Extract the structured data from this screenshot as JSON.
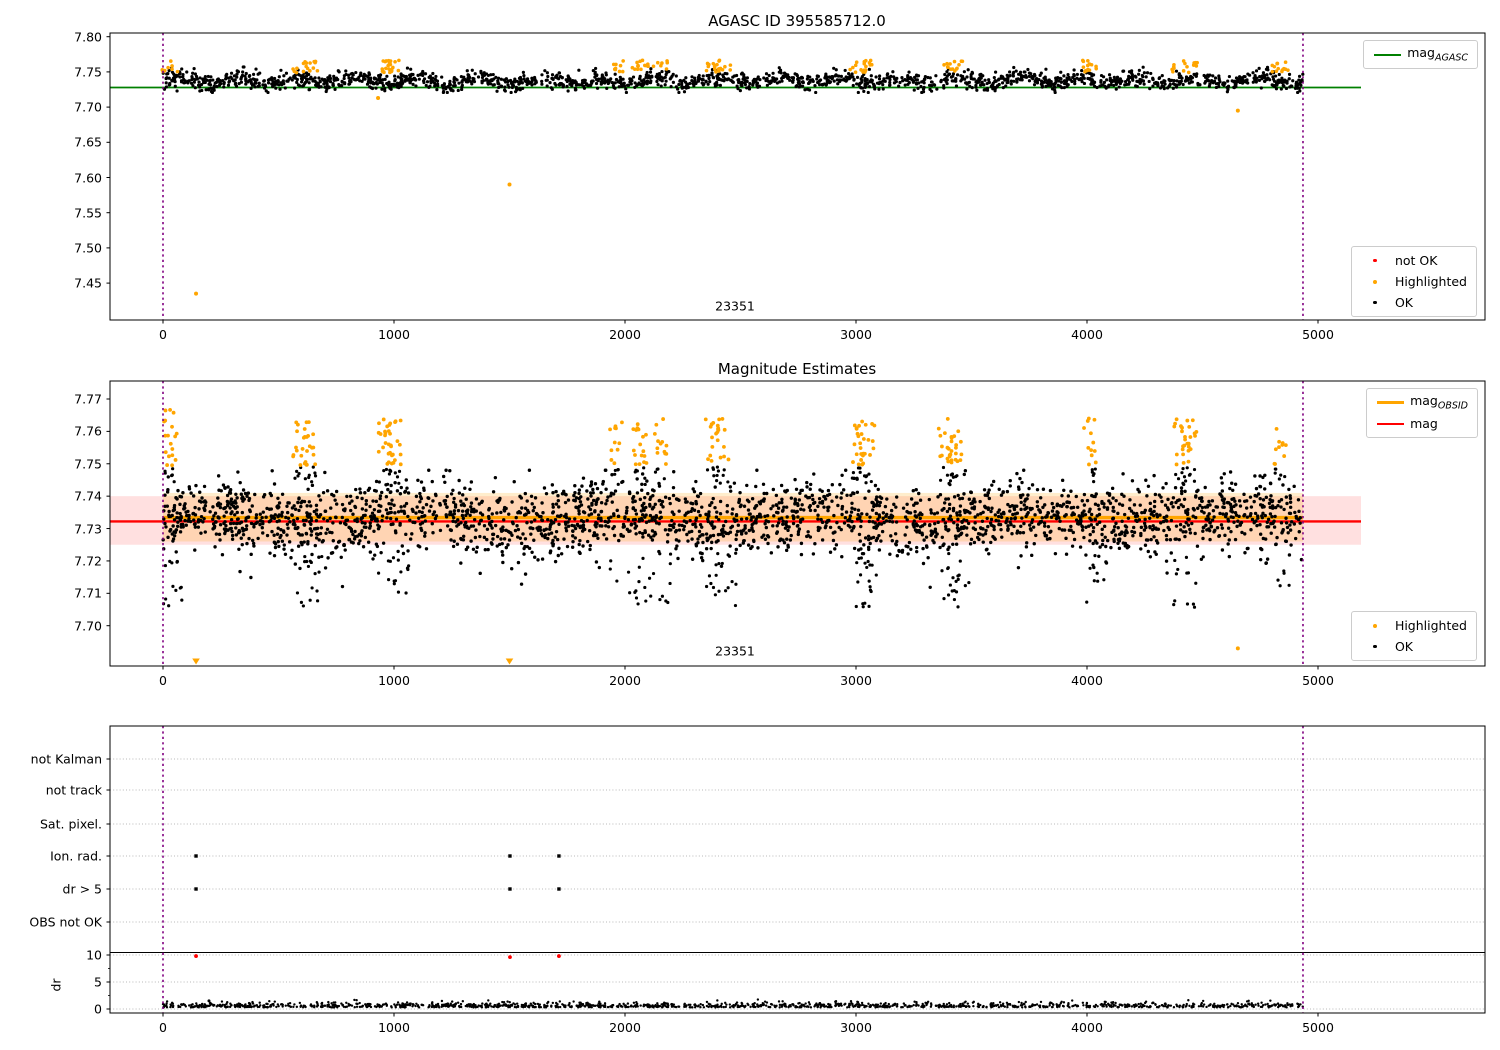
{
  "colors": {
    "ok": "#000000",
    "highlighted": "#ffa500",
    "not_ok": "#ff0000",
    "mag_agasc": "#008000",
    "mag": "#ff0000",
    "mag_obsid": "#ffa500",
    "obs_marker": "#800080",
    "grid": "#b8b8b8",
    "band_mag": "rgba(255,0,0,0.12)",
    "band_obsid": "rgba(255,165,0,0.20)"
  },
  "chart_data": [
    {
      "name": "agasc-mag-panel",
      "type": "scatter",
      "title": "AGASC ID 395585712.0",
      "y_ticks": [
        7.8,
        7.75,
        7.7,
        7.65,
        7.6,
        7.55,
        7.5,
        7.45
      ],
      "x_ticks": [
        0,
        1000,
        2000,
        3000,
        4000,
        5000
      ],
      "ylim": [
        7.3975,
        7.8053
      ],
      "obsid_label": "23351",
      "obs_interval": [
        0,
        4935
      ],
      "mag_agasc_line": 7.7278,
      "legend_line": {
        "main": "mag",
        "sub": "AGASC"
      },
      "legend_points": [
        {
          "label": "not OK",
          "color": "#ff0000"
        },
        {
          "label": "Highlighted",
          "color": "#ffa500"
        },
        {
          "label": "OK",
          "color": "#000000"
        }
      ],
      "black_band": {
        "n": 1900,
        "mean": 7.7375,
        "sd": 0.0058,
        "min": 7.7208,
        "max": 7.757,
        "wave_amp": 0.004,
        "wave_period": 260
      },
      "orange_cluster_x": [
        30,
        593,
        636,
        961,
        1004,
        1965,
        2065,
        2151,
        2376,
        2424,
        3009,
        3052,
        3385,
        3429,
        4013,
        4403,
        4446,
        4835
      ],
      "orange_cluster_y": [
        7.749,
        7.7665
      ],
      "orange_outliers": [
        [
          143,
          7.435
        ],
        [
          1500,
          7.59
        ],
        [
          931,
          7.713
        ],
        [
          4653,
          7.695
        ]
      ]
    },
    {
      "name": "magnitude-estimates-panel",
      "type": "scatter",
      "title": "Magnitude Estimates",
      "y_ticks": [
        7.77,
        7.76,
        7.75,
        7.74,
        7.73,
        7.72,
        7.71,
        7.7
      ],
      "x_ticks": [
        0,
        1000,
        2000,
        3000,
        4000,
        5000
      ],
      "obsid_label": "23351",
      "obs_interval": [
        0,
        4935
      ],
      "mag": 7.7325,
      "mag_obsid": 7.733,
      "mag_band": [
        7.725,
        7.74
      ],
      "mag_obsid_band": [
        7.726,
        7.741
      ],
      "legend_lines": [
        {
          "main": "mag",
          "sub": "OBSID",
          "color": "#ffa500"
        },
        {
          "main": "mag",
          "sub": "",
          "color": "#ff0000"
        }
      ],
      "legend_points": [
        {
          "label": "Highlighted",
          "color": "#ffa500"
        },
        {
          "label": "OK",
          "color": "#000000"
        }
      ],
      "black_band": {
        "n": 2600,
        "mean": 7.7332,
        "sd": 0.0056,
        "min": 7.7045,
        "max": 7.748
      },
      "black_dip_cluster_x": [
        30,
        593,
        636,
        961,
        1004,
        1965,
        2065,
        2151,
        2376,
        2424,
        3009,
        3052,
        3385,
        3429,
        4013,
        4403,
        4446,
        4835
      ],
      "black_dip_y": [
        7.7055,
        7.7225
      ],
      "orange_cluster_x": [
        30,
        593,
        636,
        961,
        1004,
        1965,
        2065,
        2151,
        2376,
        2424,
        3009,
        3052,
        3385,
        3429,
        4013,
        4403,
        4446,
        4835
      ],
      "orange_cluster_y": [
        7.7495,
        7.764
      ],
      "first_cluster_top": 7.7675,
      "orange_outliers": [
        [
          4653,
          7.693
        ]
      ],
      "clipped_below_x": [
        143,
        1500
      ]
    },
    {
      "name": "quality-flags-panel",
      "type": "scatter",
      "categories": [
        "not Kalman",
        "not track",
        "Sat. pixel.",
        "Ion. rad.",
        "dr > 5",
        "OBS not OK"
      ],
      "dr_ticks": [
        10,
        5,
        0
      ],
      "dr_label": "dr",
      "x_ticks": [
        0,
        1000,
        2000,
        3000,
        4000,
        5000
      ],
      "obs_interval": [
        0,
        4935
      ],
      "flag_points": [
        {
          "x": 143,
          "flag": "Ion. rad."
        },
        {
          "x": 143,
          "flag": "dr > 5"
        },
        {
          "x": 1502,
          "flag": "Ion. rad."
        },
        {
          "x": 1502,
          "flag": "dr > 5"
        },
        {
          "x": 1714,
          "flag": "Ion. rad."
        },
        {
          "x": 1714,
          "flag": "dr > 5"
        }
      ],
      "dr_red_points": [
        [
          143,
          9.8
        ],
        [
          1502,
          9.6
        ],
        [
          1714,
          9.8
        ]
      ],
      "dr_black_outliers": [
        [
          199,
          1.5
        ]
      ],
      "dr_band": {
        "n": 1400,
        "base": 0.3,
        "spread": 0.45
      }
    }
  ]
}
